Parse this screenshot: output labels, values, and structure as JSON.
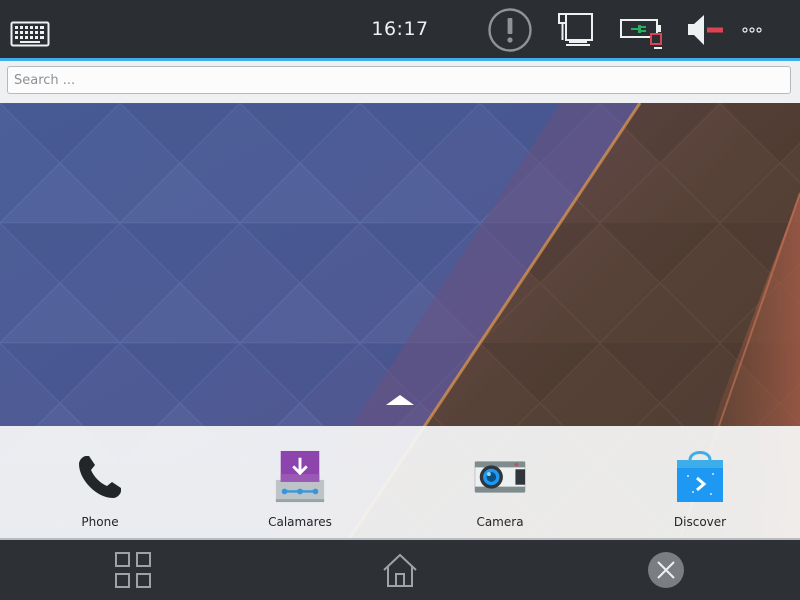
{
  "top_panel": {
    "clock": "16:17",
    "indicators": {
      "keyboard": "keyboard-icon",
      "notifications": "exclamation-circle-icon",
      "network": "wired-network-disconnected-icon",
      "battery": "battery-charging-icon",
      "volume": "speaker-muted-icon",
      "more": "ellipsis-icon"
    }
  },
  "search": {
    "placeholder": "Search ..."
  },
  "favorites": [
    {
      "label": "Phone",
      "icon": "phone-icon"
    },
    {
      "label": "Calamares",
      "icon": "calamares-installer-icon"
    },
    {
      "label": "Camera",
      "icon": "camera-icon"
    },
    {
      "label": "Discover",
      "icon": "discover-store-icon"
    }
  ],
  "bottom_nav": {
    "app_grid": "app-grid-icon",
    "home": "home-icon",
    "close": "close-icon"
  },
  "colors": {
    "panel": "#2b2e32",
    "accent": "#3daee9",
    "dock_background": "#f6f7f8",
    "alert_red": "#da4453"
  }
}
